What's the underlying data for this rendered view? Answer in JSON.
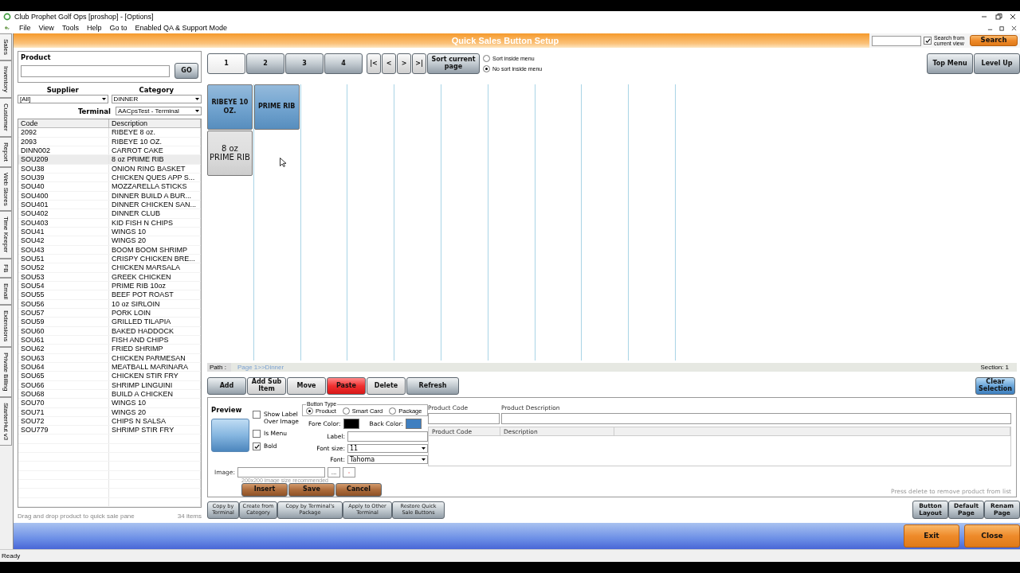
{
  "window": {
    "title": "Club Prophet Golf Ops [proshop] - [Options]"
  },
  "menu": [
    "File",
    "View",
    "Tools",
    "Help",
    "Go to",
    "Enabled QA & Support Mode"
  ],
  "side_tabs": [
    "Sales",
    "Inventory",
    "Customer",
    "Report",
    "Web Stores",
    "Time Keeper",
    "FB",
    "Email",
    "Extensions",
    "Private Billing",
    "StarterHut v3"
  ],
  "header": {
    "title": "Quick Sales Button Setup",
    "search_option": {
      "label": "Search from current view",
      "checked": true
    },
    "search_button": "Search"
  },
  "product_panel": {
    "product_label": "Product",
    "go_button": "GO",
    "supplier_label": "Supplier",
    "supplier_value": "[All]",
    "category_label": "Category",
    "category_value": "DINNER",
    "terminal_label": "Terminal",
    "terminal_value": "AACpsTest - Terminal",
    "columns": [
      "Code",
      "Description"
    ],
    "rows": [
      {
        "code": "2092",
        "description": "RIBEYE 8 oz.",
        "selected": false
      },
      {
        "code": "2093",
        "description": "RIBEYE 10 OZ.",
        "selected": false
      },
      {
        "code": "DINN002",
        "description": "CARROT CAKE",
        "selected": false
      },
      {
        "code": "SOU209",
        "description": "8 oz PRIME RIB",
        "selected": true
      },
      {
        "code": "SOU38",
        "description": "ONION RING BASKET",
        "selected": false
      },
      {
        "code": "SOU39",
        "description": "CHICKEN QUES APP S...",
        "selected": false
      },
      {
        "code": "SOU40",
        "description": "MOZZARELLA STICKS",
        "selected": false
      },
      {
        "code": "SOU400",
        "description": "DINNER BUILD A BUR...",
        "selected": false
      },
      {
        "code": "SOU401",
        "description": "DINNER CHICKEN SAN...",
        "selected": false
      },
      {
        "code": "SOU402",
        "description": "DINNER CLUB",
        "selected": false
      },
      {
        "code": "SOU403",
        "description": "KID FISH N CHIPS",
        "selected": false
      },
      {
        "code": "SOU41",
        "description": "WINGS 10",
        "selected": false
      },
      {
        "code": "SOU42",
        "description": "WINGS 20",
        "selected": false
      },
      {
        "code": "SOU43",
        "description": "BOOM BOOM SHRIMP",
        "selected": false
      },
      {
        "code": "SOU51",
        "description": "CRISPY CHICKEN BRE...",
        "selected": false
      },
      {
        "code": "SOU52",
        "description": "CHICKEN MARSALA",
        "selected": false
      },
      {
        "code": "SOU53",
        "description": "GREEK CHICKEN",
        "selected": false
      },
      {
        "code": "SOU54",
        "description": "PRIME RIB 10oz",
        "selected": false
      },
      {
        "code": "SOU55",
        "description": "BEEF POT ROAST",
        "selected": false
      },
      {
        "code": "SOU56",
        "description": "10 oz SIRLOIN",
        "selected": false
      },
      {
        "code": "SOU57",
        "description": "PORK LOIN",
        "selected": false
      },
      {
        "code": "SOU59",
        "description": "GRILLED TILAPIA",
        "selected": false
      },
      {
        "code": "SOU60",
        "description": "BAKED HADDOCK",
        "selected": false
      },
      {
        "code": "SOU61",
        "description": "FISH AND CHIPS",
        "selected": false
      },
      {
        "code": "SOU62",
        "description": "FRIED SHRIMP",
        "selected": false
      },
      {
        "code": "SOU63",
        "description": "CHICKEN PARMESAN",
        "selected": false
      },
      {
        "code": "SOU64",
        "description": "MEATBALL MARINARA",
        "selected": false
      },
      {
        "code": "SOU65",
        "description": "CHICKEN STIR FRY",
        "selected": false
      },
      {
        "code": "SOU66",
        "description": "SHRIMP LINGUINI",
        "selected": false
      },
      {
        "code": "SOU68",
        "description": "BUILD A CHICKEN",
        "selected": false
      },
      {
        "code": "SOU70",
        "description": "WINGS 10",
        "selected": false
      },
      {
        "code": "SOU71",
        "description": "WINGS 20",
        "selected": false
      },
      {
        "code": "SOU72",
        "description": "CHIPS N SALSA",
        "selected": false
      },
      {
        "code": "SOU779",
        "description": "SHRIMP STIR FRY",
        "selected": false
      }
    ],
    "hint": "Drag and drop product to quick sale pane",
    "count": "34 items"
  },
  "pages": {
    "tabs": [
      {
        "label": "1",
        "selected": true
      },
      {
        "label": "2",
        "selected": false
      },
      {
        "label": "3",
        "selected": false
      },
      {
        "label": "4",
        "selected": false
      }
    ],
    "nav": [
      "|<",
      "<",
      ">",
      ">|"
    ],
    "sort_button": "Sort current page",
    "sort_options": [
      {
        "label": "Sort inside menu",
        "selected": false
      },
      {
        "label": "No sort inside menu",
        "selected": true
      }
    ],
    "top_menu": "Top Menu",
    "level_up": "Level Up"
  },
  "button_grid": {
    "rows": [
      [
        {
          "label": "RIBEYE 10 OZ.",
          "color": "#5b95c8",
          "bold": true
        },
        {
          "label": "PRIME RIB",
          "color": "#5b95c8",
          "bold": true
        }
      ],
      [
        {
          "label": "8 oz PRIME RIB",
          "color": "#d8d8d8",
          "bold": false
        }
      ]
    ]
  },
  "path": {
    "label": "Path :",
    "value": "Page 1>>Dinner",
    "section": "Section: 1"
  },
  "actions": [
    {
      "label": "Add",
      "kind": "dark"
    },
    {
      "label": "Add Sub Item",
      "kind": "light"
    },
    {
      "label": "Move",
      "kind": "light"
    },
    {
      "label": "Paste",
      "kind": "alert"
    },
    {
      "label": "Delete",
      "kind": "light"
    },
    {
      "label": "Refresh",
      "kind": "dark"
    }
  ],
  "clear_selection": "Clear Selection",
  "editor": {
    "preview_label": "Preview",
    "options": [
      {
        "label": "Show Label Over Image",
        "checked": false
      },
      {
        "label": "Is Menu",
        "checked": false
      },
      {
        "label": "Bold",
        "checked": true
      }
    ],
    "button_type": {
      "legend": "Button Type",
      "options": [
        {
          "label": "Product",
          "selected": true
        },
        {
          "label": "Smart Card",
          "selected": false
        },
        {
          "label": "Package",
          "selected": false
        }
      ]
    },
    "colors": [
      {
        "label": "Fore Color:",
        "color": "#000000"
      },
      {
        "label": "Back Color:",
        "color": "#3f7fc0"
      }
    ],
    "label_label": "Label:",
    "font_size_label": "Font size:",
    "font_size": "11",
    "font_label": "Font:",
    "font": "Tahoma",
    "image_label": "Image:",
    "browse_button": "...",
    "image_hint": "200x200 image size recommended",
    "buttons": [
      "Insert",
      "Save",
      "Cancel"
    ]
  },
  "products": {
    "code_label": "Product Code",
    "description_label": "Product Description",
    "columns": [
      "Product Code",
      "Description"
    ],
    "hint": "Press delete to remove product from list"
  },
  "footer_buttons": [
    "Copy by Terminal",
    "Create from Category",
    "Copy by Terminal's Package",
    "Apply to Other Terminal",
    "Restore Quick Sale Buttons"
  ],
  "page_buttons": [
    "Button Layout",
    "Default Page",
    "Renam Page"
  ],
  "exit_buttons": [
    "Exit",
    "Close"
  ],
  "status": "Ready"
}
